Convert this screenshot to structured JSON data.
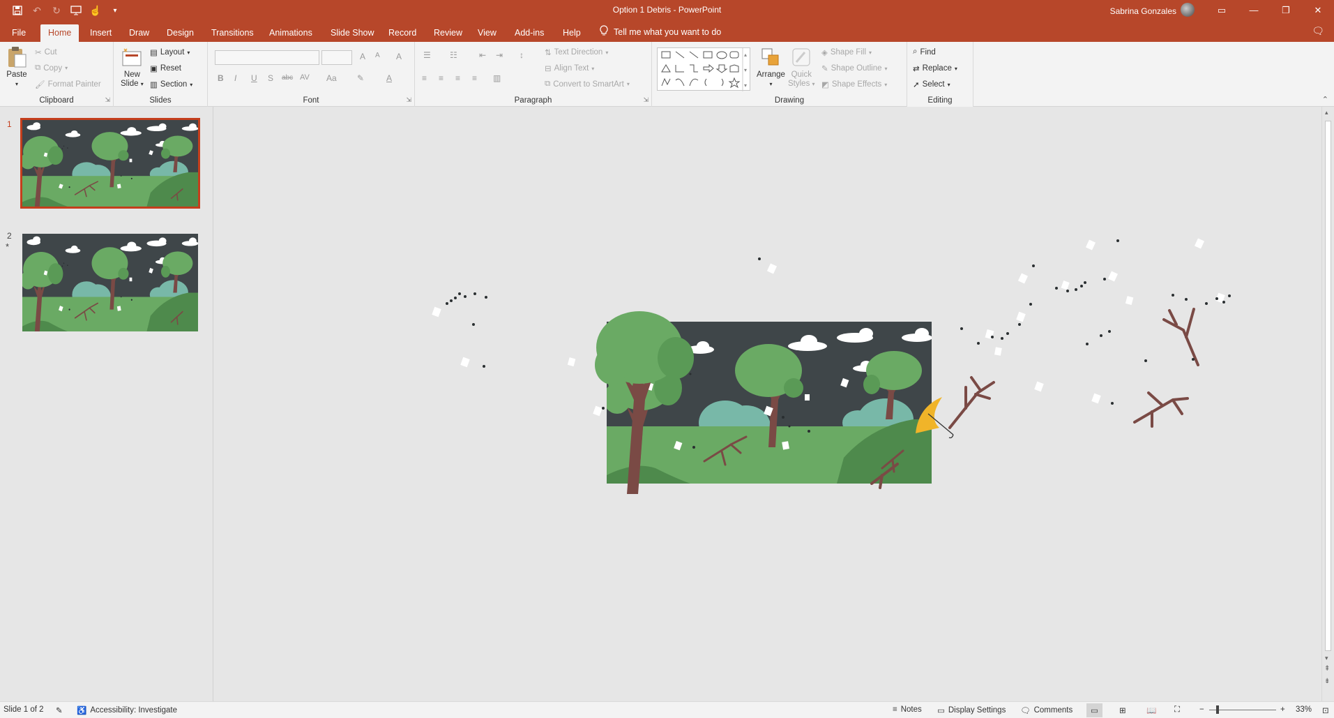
{
  "window": {
    "title": "Option 1 Debris  -  PowerPoint",
    "user": "Sabrina Gonzales",
    "controls": [
      "ribbon-display",
      "minimize",
      "restore",
      "close"
    ]
  },
  "quick_access": [
    "save-icon",
    "undo-icon",
    "redo-icon",
    "present-icon",
    "touch-mode-icon",
    "customize-icon"
  ],
  "tabs": [
    "File",
    "Home",
    "Insert",
    "Draw",
    "Design",
    "Transitions",
    "Animations",
    "Slide Show",
    "Record",
    "Review",
    "View",
    "Add-ins",
    "Help"
  ],
  "active_tab": "Home",
  "tell_me": "Tell me what you want to do",
  "ribbon": {
    "clipboard": {
      "label": "Clipboard",
      "paste": "Paste",
      "cut": "Cut",
      "copy": "Copy",
      "format_painter": "Format Painter"
    },
    "slides": {
      "label": "Slides",
      "new_slide_1": "New",
      "new_slide_2": "Slide",
      "layout": "Layout",
      "reset": "Reset",
      "section": "Section"
    },
    "font": {
      "label": "Font",
      "bold": "B",
      "italic": "I",
      "underline": "U",
      "shadow": "S",
      "strike": "abc",
      "spacing": "AV",
      "case": "Aa",
      "grow": "A",
      "shrink": "A",
      "clear": "A",
      "color": "A"
    },
    "paragraph": {
      "label": "Paragraph",
      "text_direction": "Text Direction",
      "align_text": "Align Text",
      "convert_smartart": "Convert to SmartArt"
    },
    "drawing": {
      "label": "Drawing",
      "arrange": "Arrange",
      "quick_styles_1": "Quick",
      "quick_styles_2": "Styles",
      "shape_fill": "Shape Fill",
      "shape_outline": "Shape Outline",
      "shape_effects": "Shape Effects"
    },
    "editing": {
      "label": "Editing",
      "find": "Find",
      "replace": "Replace",
      "select": "Select"
    }
  },
  "slides": [
    {
      "number": "1",
      "marker": ""
    },
    {
      "number": "2",
      "marker": "*"
    }
  ],
  "selected_slide": 1,
  "status": {
    "slide_info": "Slide 1 of 2",
    "accessibility": "Accessibility: Investigate",
    "notes": "Notes",
    "display_settings": "Display Settings",
    "comments": "Comments",
    "zoom": "33%"
  },
  "colors": {
    "accent": "#b7472a",
    "slide_sky": "#3f4649",
    "grass": "#6aaa64",
    "tree_leaf": "#6aaa64",
    "trunk": "#7a4a45",
    "umbrella": "#f0b429"
  }
}
